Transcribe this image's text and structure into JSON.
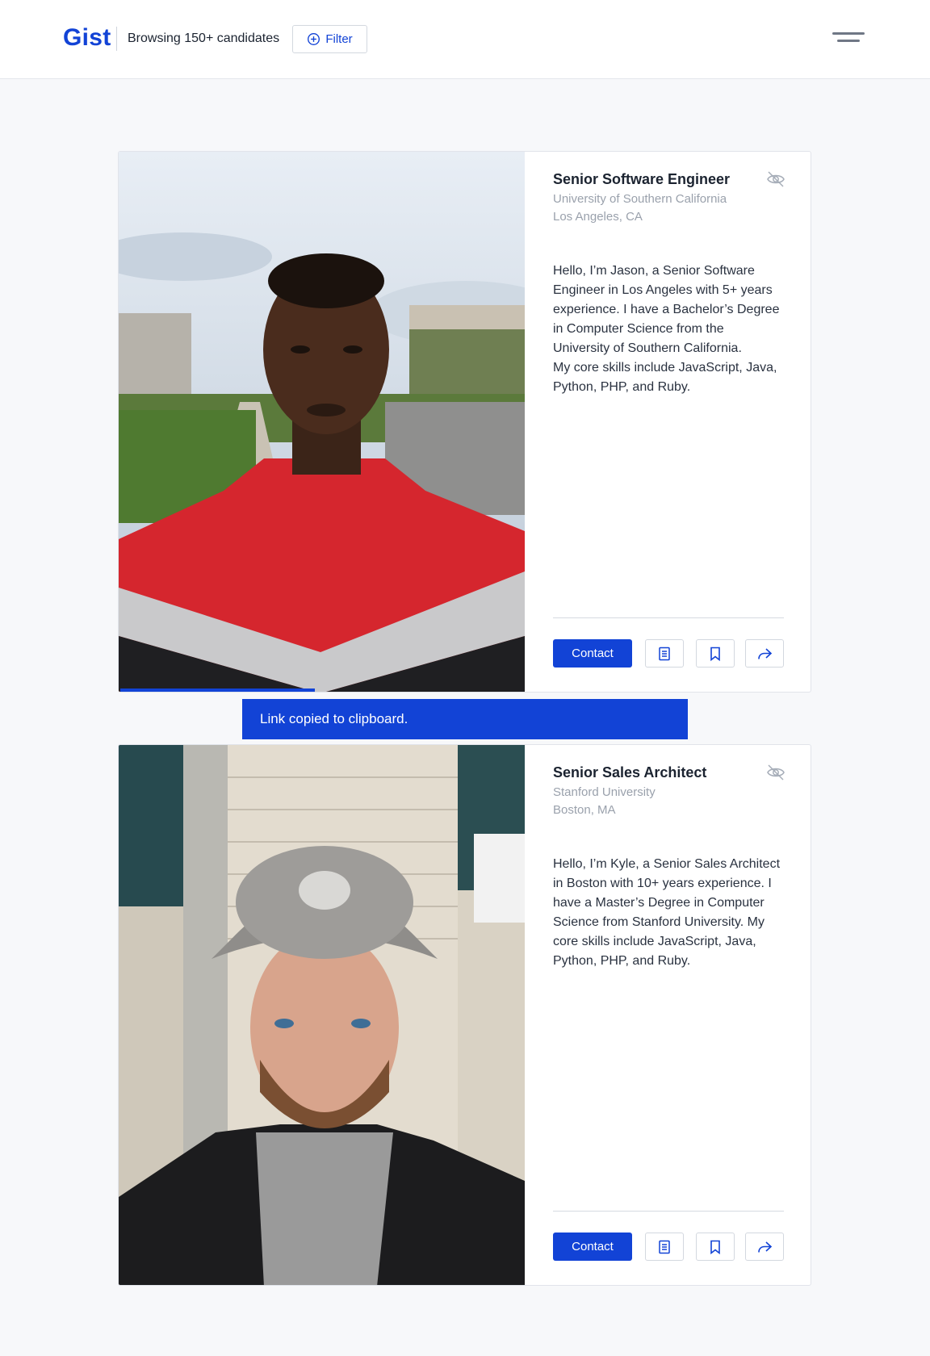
{
  "header": {
    "logo": "Gist",
    "browsing_text": "Browsing 150+ candidates",
    "filter_label": "Filter"
  },
  "toast": {
    "message": "Link copied to clipboard."
  },
  "colors": {
    "accent": "#1243d6",
    "muted_text": "#9aa1ac"
  },
  "candidates": [
    {
      "title": "Senior Software Engineer",
      "school": "University of Southern California",
      "location": "Los Angeles, CA",
      "bio": "Hello, I’m Jason, a Senior Software Engineer in Los Angeles with 5+ years experience. I have a Bachelor’s Degree in Computer Science from the University of Southern California.\nMy core skills include JavaScript, Java, Python, PHP, and Ruby.",
      "contact_label": "Contact",
      "progress": 0.48
    },
    {
      "title": "Senior Sales Architect",
      "school": "Stanford University",
      "location": "Boston, MA",
      "bio": "Hello, I’m Kyle, a Senior Sales Architect in Boston with 10+ years experience. I have a Master’s Degree in Computer Science from Stanford University. My core skills include JavaScript, Java, Python, PHP, and Ruby.",
      "contact_label": "Contact"
    }
  ],
  "icons": {
    "hide": "eye-off-icon",
    "resume": "document-icon",
    "save": "bookmark-icon",
    "share": "share-arrow-icon",
    "filter": "plus-circle-icon",
    "menu": "hamburger-menu-icon"
  }
}
